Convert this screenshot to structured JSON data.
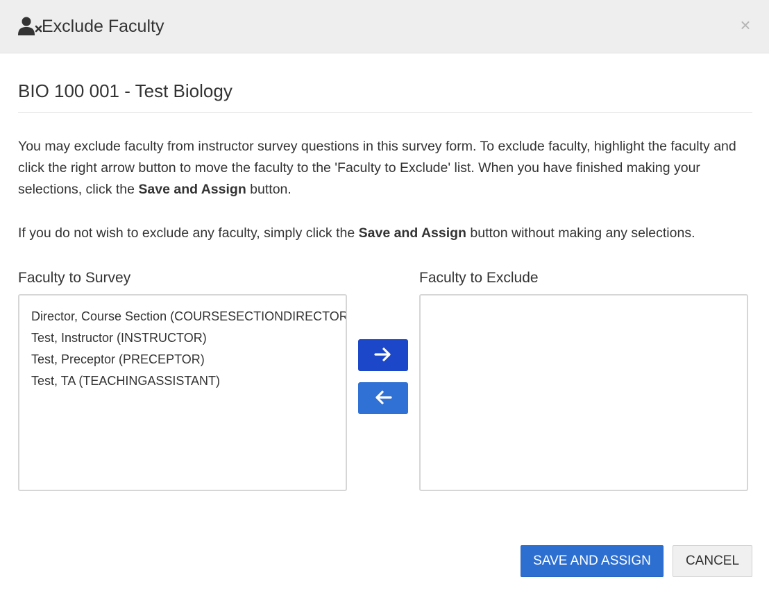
{
  "header": {
    "title": "Exclude Faculty",
    "icon": "user-times-icon",
    "close_label": "×"
  },
  "course": {
    "title": "BIO 100 001 - Test Biology"
  },
  "instructions": {
    "p1_before": "You may exclude faculty from instructor survey questions in this survey form. To exclude faculty, highlight the faculty and click the right arrow button to move the faculty to the 'Faculty to Exclude' list. When you have finished making your selections, click the ",
    "p1_bold": "Save and Assign",
    "p1_after": " button.",
    "p2_before": "If you do not wish to exclude any faculty, simply click the ",
    "p2_bold": "Save and Assign",
    "p2_after": " button without making any selections."
  },
  "survey_list": {
    "label": "Faculty to Survey",
    "items": [
      "Director, Course Section (COURSESECTIONDIRECTOR)",
      "Test, Instructor (INSTRUCTOR)",
      "Test, Preceptor (PRECEPTOR)",
      "Test, TA (TEACHINGASSISTANT)"
    ]
  },
  "exclude_list": {
    "label": "Faculty to Exclude",
    "items": []
  },
  "controls": {
    "move_right_icon": "arrow-right-icon",
    "move_left_icon": "arrow-left-icon"
  },
  "footer": {
    "save_label": "SAVE AND ASSIGN",
    "cancel_label": "CANCEL"
  },
  "colors": {
    "header_bg": "#eeeeee",
    "primary": "#2d6fd0",
    "arrow_right_bg": "#1c47c8",
    "arrow_left_bg": "#2f71d4"
  }
}
